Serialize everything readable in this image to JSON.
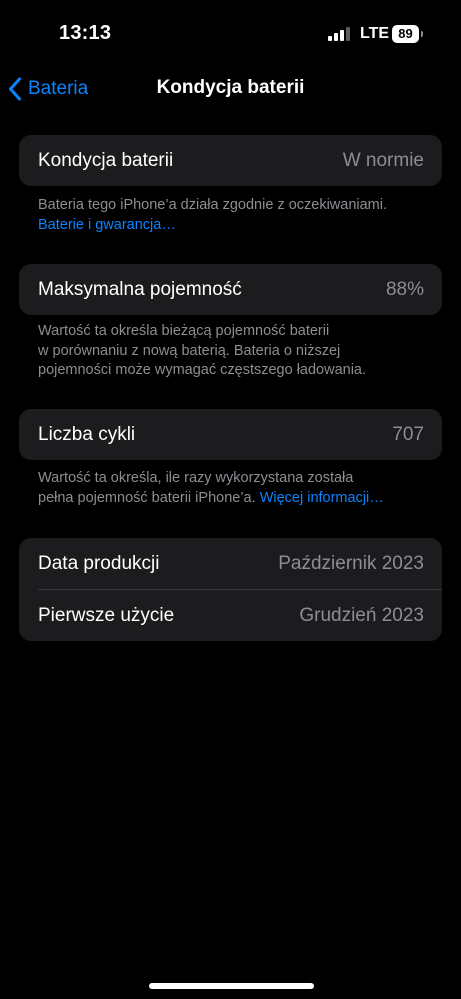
{
  "status_bar": {
    "time": "13:13",
    "network": "LTE",
    "battery_level": "89",
    "signal_bars_active": 3,
    "signal_bars_total": 4,
    "signal_icon": "cellular-signal-icon"
  },
  "nav": {
    "back_icon": "chevron-left-icon",
    "back_label": "Bateria",
    "title": "Kondycja baterii"
  },
  "health": {
    "label": "Kondycja baterii",
    "value": "W normie",
    "footnote": "Bateria tego iPhone’a działa zgodnie z oczekiwaniami.",
    "link": "Baterie i gwarancja…"
  },
  "capacity": {
    "label": "Maksymalna pojemność",
    "value": "88%",
    "footnote_line1": "Wartość ta określa bieżącą pojemność baterii",
    "footnote_line2": "w porównaniu z nową baterią. Bateria o niższej",
    "footnote_line3": "pojemności może wymagać częstszego ładowania."
  },
  "cycles": {
    "label": "Liczba cykli",
    "value": "707",
    "footnote_line1": "Wartość ta określa, ile razy wykorzystana została",
    "footnote_line2": "pełna pojemność baterii iPhone’a.",
    "link": "Więcej informacji…"
  },
  "dates": {
    "manufacture_label": "Data produkcji",
    "manufacture_value": "Październik 2023",
    "first_use_label": "Pierwsze użycie",
    "first_use_value": "Grudzień 2023"
  },
  "colors": {
    "background": "#000000",
    "cell": "#1c1c1e",
    "accent": "#0a84ff",
    "secondary_text": "#8d8d93"
  }
}
